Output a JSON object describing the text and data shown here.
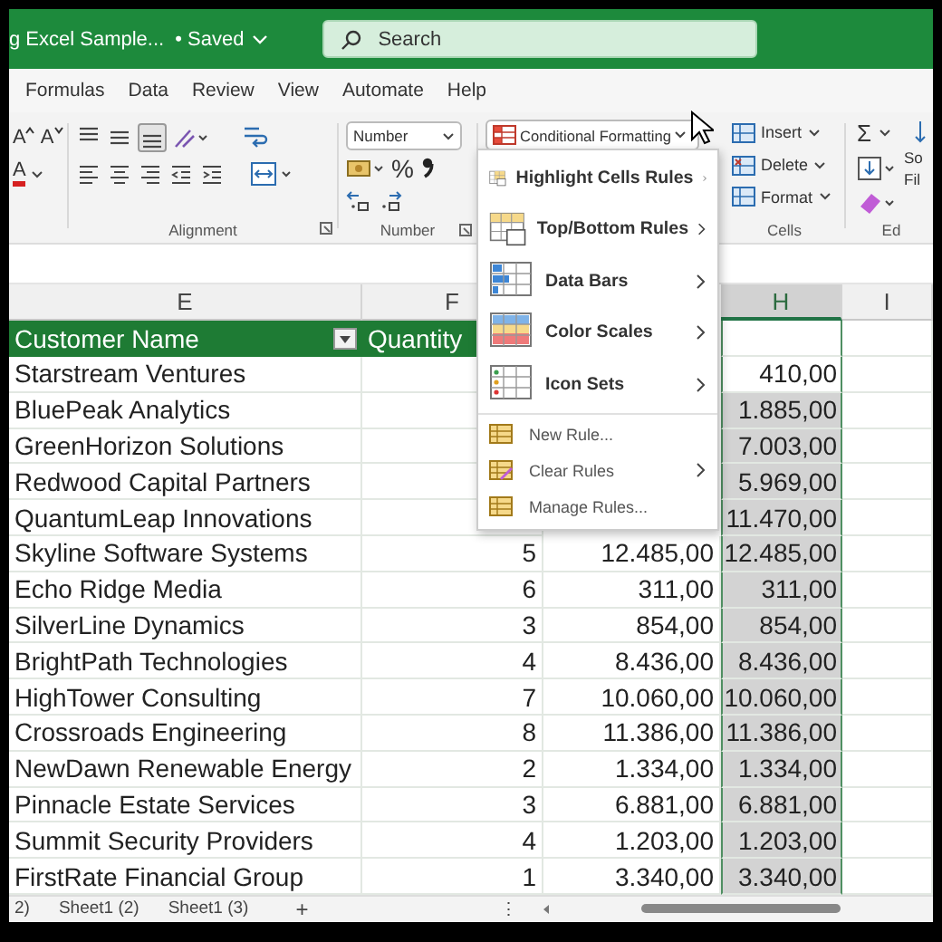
{
  "title_bar": {
    "document_title": "g Excel Sample...",
    "status": "• Saved",
    "search": {
      "placeholder": "Search"
    }
  },
  "menu_tabs": [
    "Formulas",
    "Data",
    "Review",
    "View",
    "Automate",
    "Help"
  ],
  "ribbon": {
    "font": {
      "grow": "A",
      "shrink": "A",
      "font_color": "A"
    },
    "alignment": {
      "label": "Alignment",
      "vertical_align": [
        {
          "kind": "top",
          "selected": false
        },
        {
          "kind": "middle",
          "selected": false
        },
        {
          "kind": "bottom",
          "selected": true
        }
      ]
    },
    "number": {
      "format": "Number",
      "percent": "%",
      "label": "Number"
    },
    "conditional_formatting": "Conditional Formatting",
    "cells": {
      "buttons": [
        "Insert",
        "Delete",
        "Format"
      ],
      "label": "Cells"
    },
    "editing": {
      "sum": "Σ",
      "sort_filter": [
        "So",
        "Fil"
      ],
      "label": "Ed"
    }
  },
  "columns": [
    {
      "label": "E",
      "selected": false
    },
    {
      "label": "F",
      "selected": false
    },
    {
      "label": "H",
      "selected": true
    },
    {
      "label": "I",
      "selected": false
    }
  ],
  "table_header": {
    "name": "Customer Name",
    "quantity": "Quantity"
  },
  "rows": [
    {
      "name": "Starstream Ventures",
      "h": "410,00",
      "selected": false
    },
    {
      "name": "BluePeak Analytics",
      "h": "1.885,00",
      "selected": true
    },
    {
      "name": "GreenHorizon Solutions",
      "h": "7.003,00",
      "selected": true
    },
    {
      "name": "Redwood Capital Partners",
      "h": "5.969,00",
      "selected": true
    },
    {
      "name": "QuantumLeap Innovations",
      "h": "11.470,00",
      "selected": true
    },
    {
      "name": "Skyline Software Systems",
      "quantity": "5",
      "g": "12.485,00",
      "h": "12.485,00",
      "selected": true
    },
    {
      "name": "Echo Ridge Media",
      "quantity": "6",
      "g": "311,00",
      "h": "311,00",
      "selected": true
    },
    {
      "name": "SilverLine Dynamics",
      "quantity": "3",
      "g": "854,00",
      "h": "854,00",
      "selected": true
    },
    {
      "name": "BrightPath Technologies",
      "quantity": "4",
      "g": "8.436,00",
      "h": "8.436,00",
      "selected": true
    },
    {
      "name": "HighTower Consulting",
      "quantity": "7",
      "g": "10.060,00",
      "h": "10.060,00",
      "selected": true
    },
    {
      "name": "Crossroads Engineering",
      "quantity": "8",
      "g": "11.386,00",
      "h": "11.386,00",
      "selected": true
    },
    {
      "name": "NewDawn Renewable Energy",
      "quantity": "2",
      "g": "1.334,00",
      "h": "1.334,00",
      "selected": true
    },
    {
      "name": "Pinnacle Estate Services",
      "quantity": "3",
      "g": "6.881,00",
      "h": "6.881,00",
      "selected": true
    },
    {
      "name": "Summit Security Providers",
      "quantity": "4",
      "g": "1.203,00",
      "h": "1.203,00",
      "selected": true
    },
    {
      "name": "FirstRate Financial Group",
      "quantity": "1",
      "g": "3.340,00",
      "h": "3.340,00",
      "selected": true
    }
  ],
  "sheet_tabs": [
    "2)",
    "Sheet1 (2)",
    "Sheet1 (3)"
  ],
  "add_sheet": "+",
  "more": "⋮",
  "menu": {
    "items": [
      {
        "kind": "large",
        "label": "Highlight Cells Rules",
        "submenu": true
      },
      {
        "kind": "large",
        "label": "Top/Bottom Rules",
        "submenu": true
      },
      {
        "kind": "large",
        "label": "Data Bars",
        "submenu": true
      },
      {
        "kind": "large",
        "label": "Color Scales",
        "submenu": true
      },
      {
        "kind": "large",
        "label": "Icon Sets",
        "submenu": true
      },
      {
        "kind": "small",
        "label": "New Rule...",
        "submenu": false
      },
      {
        "kind": "small",
        "label": "Clear Rules",
        "submenu": true
      },
      {
        "kind": "small",
        "label": "Manage Rules...",
        "submenu": false
      }
    ]
  }
}
